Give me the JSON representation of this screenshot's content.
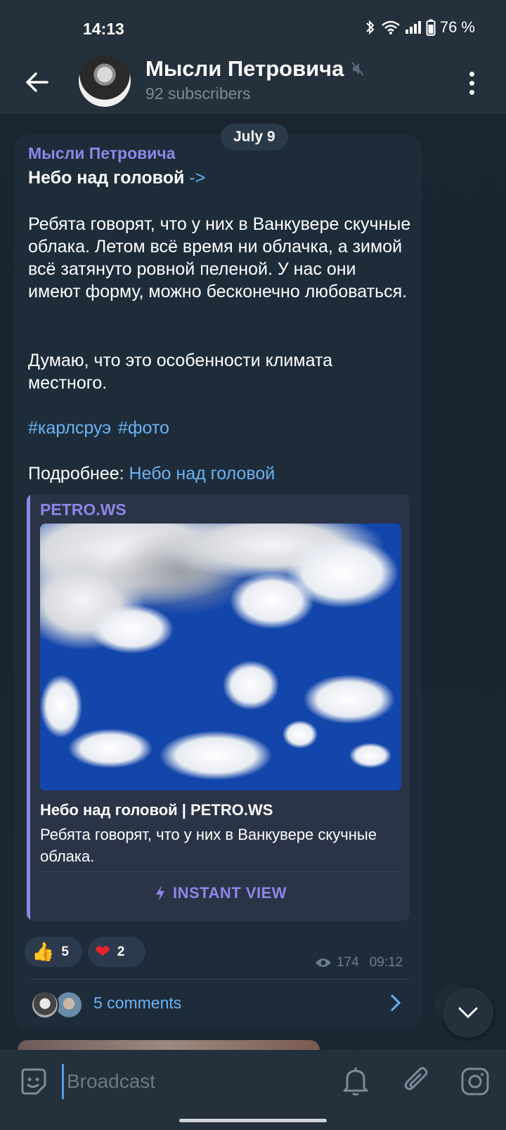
{
  "status_bar": {
    "time": "14:13",
    "battery": "76 %"
  },
  "header": {
    "title": "Мысли Петровича",
    "subtitle": "92 subscribers"
  },
  "post": {
    "date": "July 9",
    "author": "Мысли Петровича",
    "title": "Небо над головой",
    "title_arrow": "->",
    "paragraph_1": "Ребята говорят, что у них в Ванкувере скучные облака. Летом всё время ни облачка, а зимой всё затянуто ровной пеленой. У нас они имеют форму, можно бесконечно любоваться.",
    "paragraph_2": "Думаю, что это особенности климата местного.",
    "hashtags": [
      "#карлсруэ",
      "#фото"
    ],
    "more_prefix": "Подробнее: ",
    "more_link": "Небо над головой",
    "preview": {
      "site": "PETRO.WS",
      "title": "Небо над головой | PETRO.WS",
      "description": "Ребята говорят, что у них в Ванкувере скучные облака.",
      "instant_view": "INSTANT VIEW"
    },
    "reactions": [
      {
        "emoji": "👍",
        "count": "5",
        "icon": "thumbs-up-icon"
      },
      {
        "emoji": "❤",
        "count": "2",
        "icon": "heart-icon"
      }
    ],
    "views": "174",
    "time": "09:12",
    "comments_label": "5 comments"
  },
  "composer": {
    "placeholder": "Broadcast"
  },
  "colors": {
    "accent_purple": "#8e86e8",
    "link_blue": "#6ab3f3",
    "bubble": "#1e2c3a",
    "header": "#24303c"
  }
}
